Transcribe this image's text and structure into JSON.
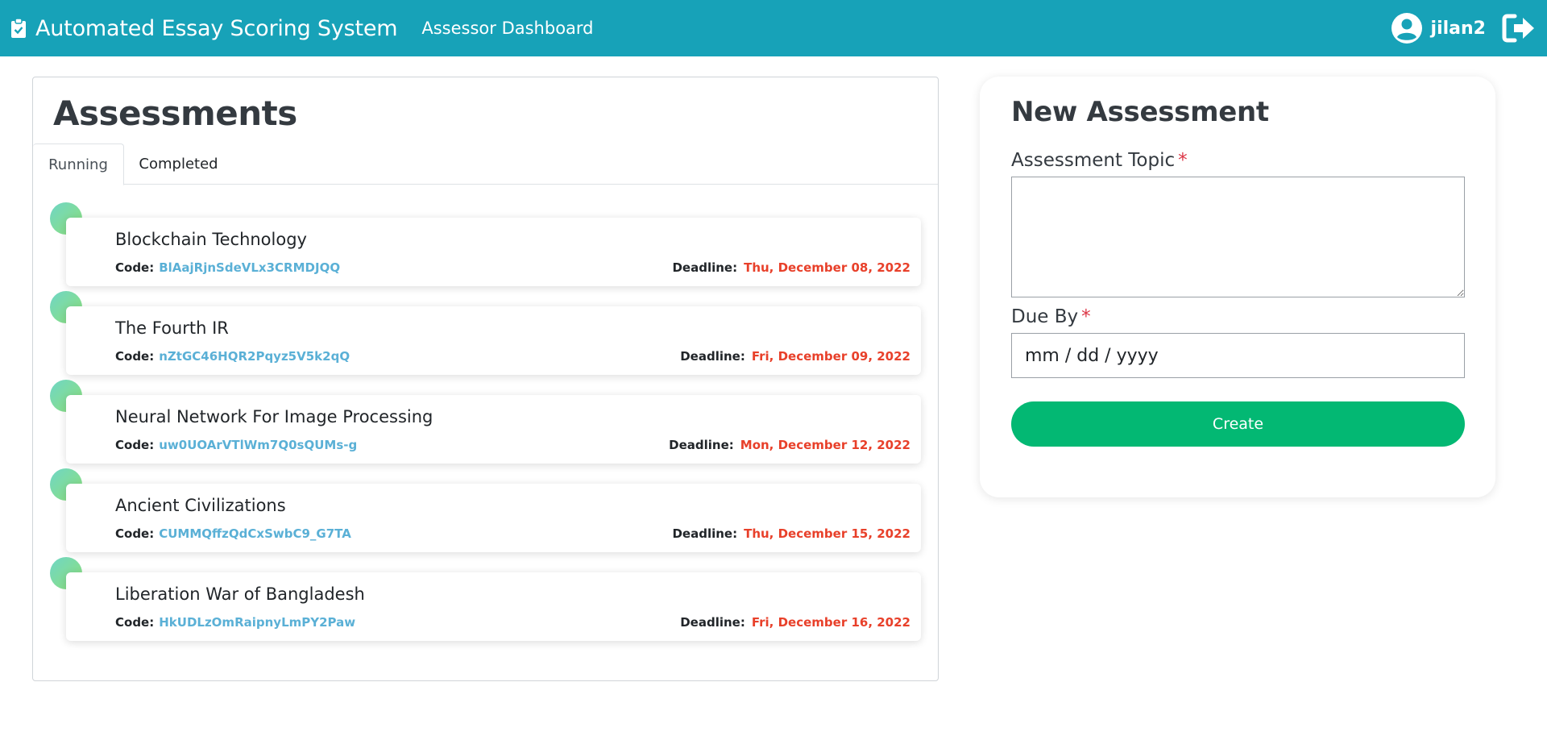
{
  "app": {
    "title": "Automated Essay Scoring System",
    "nav_link": "Assessor Dashboard",
    "username": "jilan2",
    "icons": {
      "brand": "clipboard-check-icon",
      "user": "user-circle-icon",
      "logout": "sign-out-icon"
    },
    "colors": {
      "navbar": "#17a2b8",
      "accent_button": "#03b873",
      "code": "#5ab0d6",
      "deadline": "#e8402a",
      "required": "#dc3545"
    }
  },
  "assessments": {
    "title": "Assessments",
    "tabs": [
      {
        "label": "Running",
        "active": true
      },
      {
        "label": "Completed",
        "active": false
      }
    ],
    "code_label": "Code:",
    "deadline_label": "Deadline:",
    "items": [
      {
        "title": "Blockchain Technology",
        "code": "BlAajRjnSdeVLx3CRMDJQQ",
        "deadline": "Thu, December 08, 2022"
      },
      {
        "title": "The Fourth IR",
        "code": "nZtGC46HQR2Pqyz5V5k2qQ",
        "deadline": "Fri, December 09, 2022"
      },
      {
        "title": "Neural Network For Image Processing",
        "code": "uw0UOArVTlWm7Q0sQUMs-g",
        "deadline": "Mon, December 12, 2022"
      },
      {
        "title": "Ancient Civilizations",
        "code": "CUMMQffzQdCxSwbC9_G7TA",
        "deadline": "Thu, December 15, 2022"
      },
      {
        "title": "Liberation War of Bangladesh",
        "code": "HkUDLzOmRaipnyLmPY2Paw",
        "deadline": "Fri, December 16, 2022"
      }
    ]
  },
  "new_assessment": {
    "title": "New Assessment",
    "topic_label": "Assessment Topic",
    "topic_value": "",
    "due_label": "Due By",
    "due_placeholder": "mm / dd / yyyy",
    "required_mark": "*",
    "create_label": "Create"
  }
}
